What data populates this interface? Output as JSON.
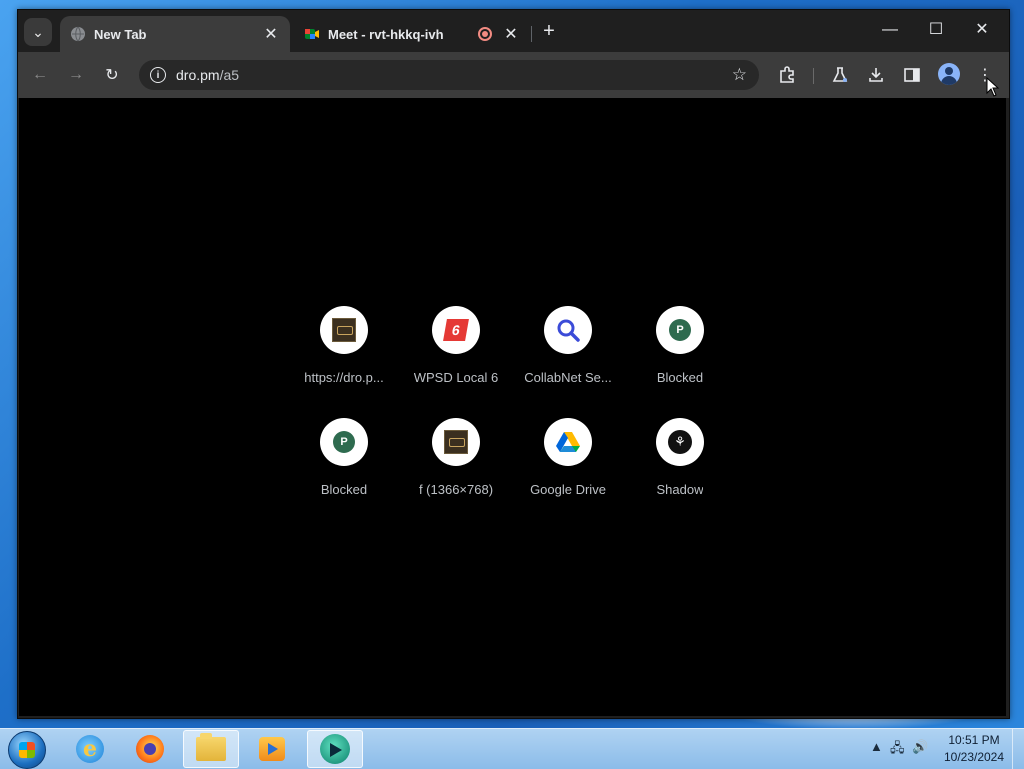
{
  "browser": {
    "tabs": [
      {
        "title": "New Tab",
        "active": true,
        "favicon": "globe-icon"
      },
      {
        "title": "Meet - rvt-hkkq-ivh",
        "active": false,
        "favicon": "meet-icon",
        "recording": true
      }
    ],
    "address_bar": {
      "host": "dro.pm",
      "path": "/a5"
    }
  },
  "shortcuts": [
    {
      "label": "https://dro.p...",
      "icon": "thumbnail-icon"
    },
    {
      "label": "WPSD Local 6",
      "icon": "wpsd-icon"
    },
    {
      "label": "CollabNet Se...",
      "icon": "search-icon"
    },
    {
      "label": "Blocked",
      "icon": "letter-p-icon",
      "letter": "P"
    },
    {
      "label": "Blocked",
      "icon": "letter-p-icon",
      "letter": "P"
    },
    {
      "label": "f (1366×768)",
      "icon": "thumbnail-icon"
    },
    {
      "label": "Google Drive",
      "icon": "drive-icon"
    },
    {
      "label": "Shadow",
      "icon": "shadow-icon"
    }
  ],
  "taskbar": {
    "clock": {
      "time": "10:51 PM",
      "date": "10/23/2024"
    }
  },
  "colors": {
    "content_bg": "#000000",
    "chrome_dark": "#1f1f1f",
    "toolbar": "#3c3c3c",
    "label_text": "#bdc1c6"
  }
}
